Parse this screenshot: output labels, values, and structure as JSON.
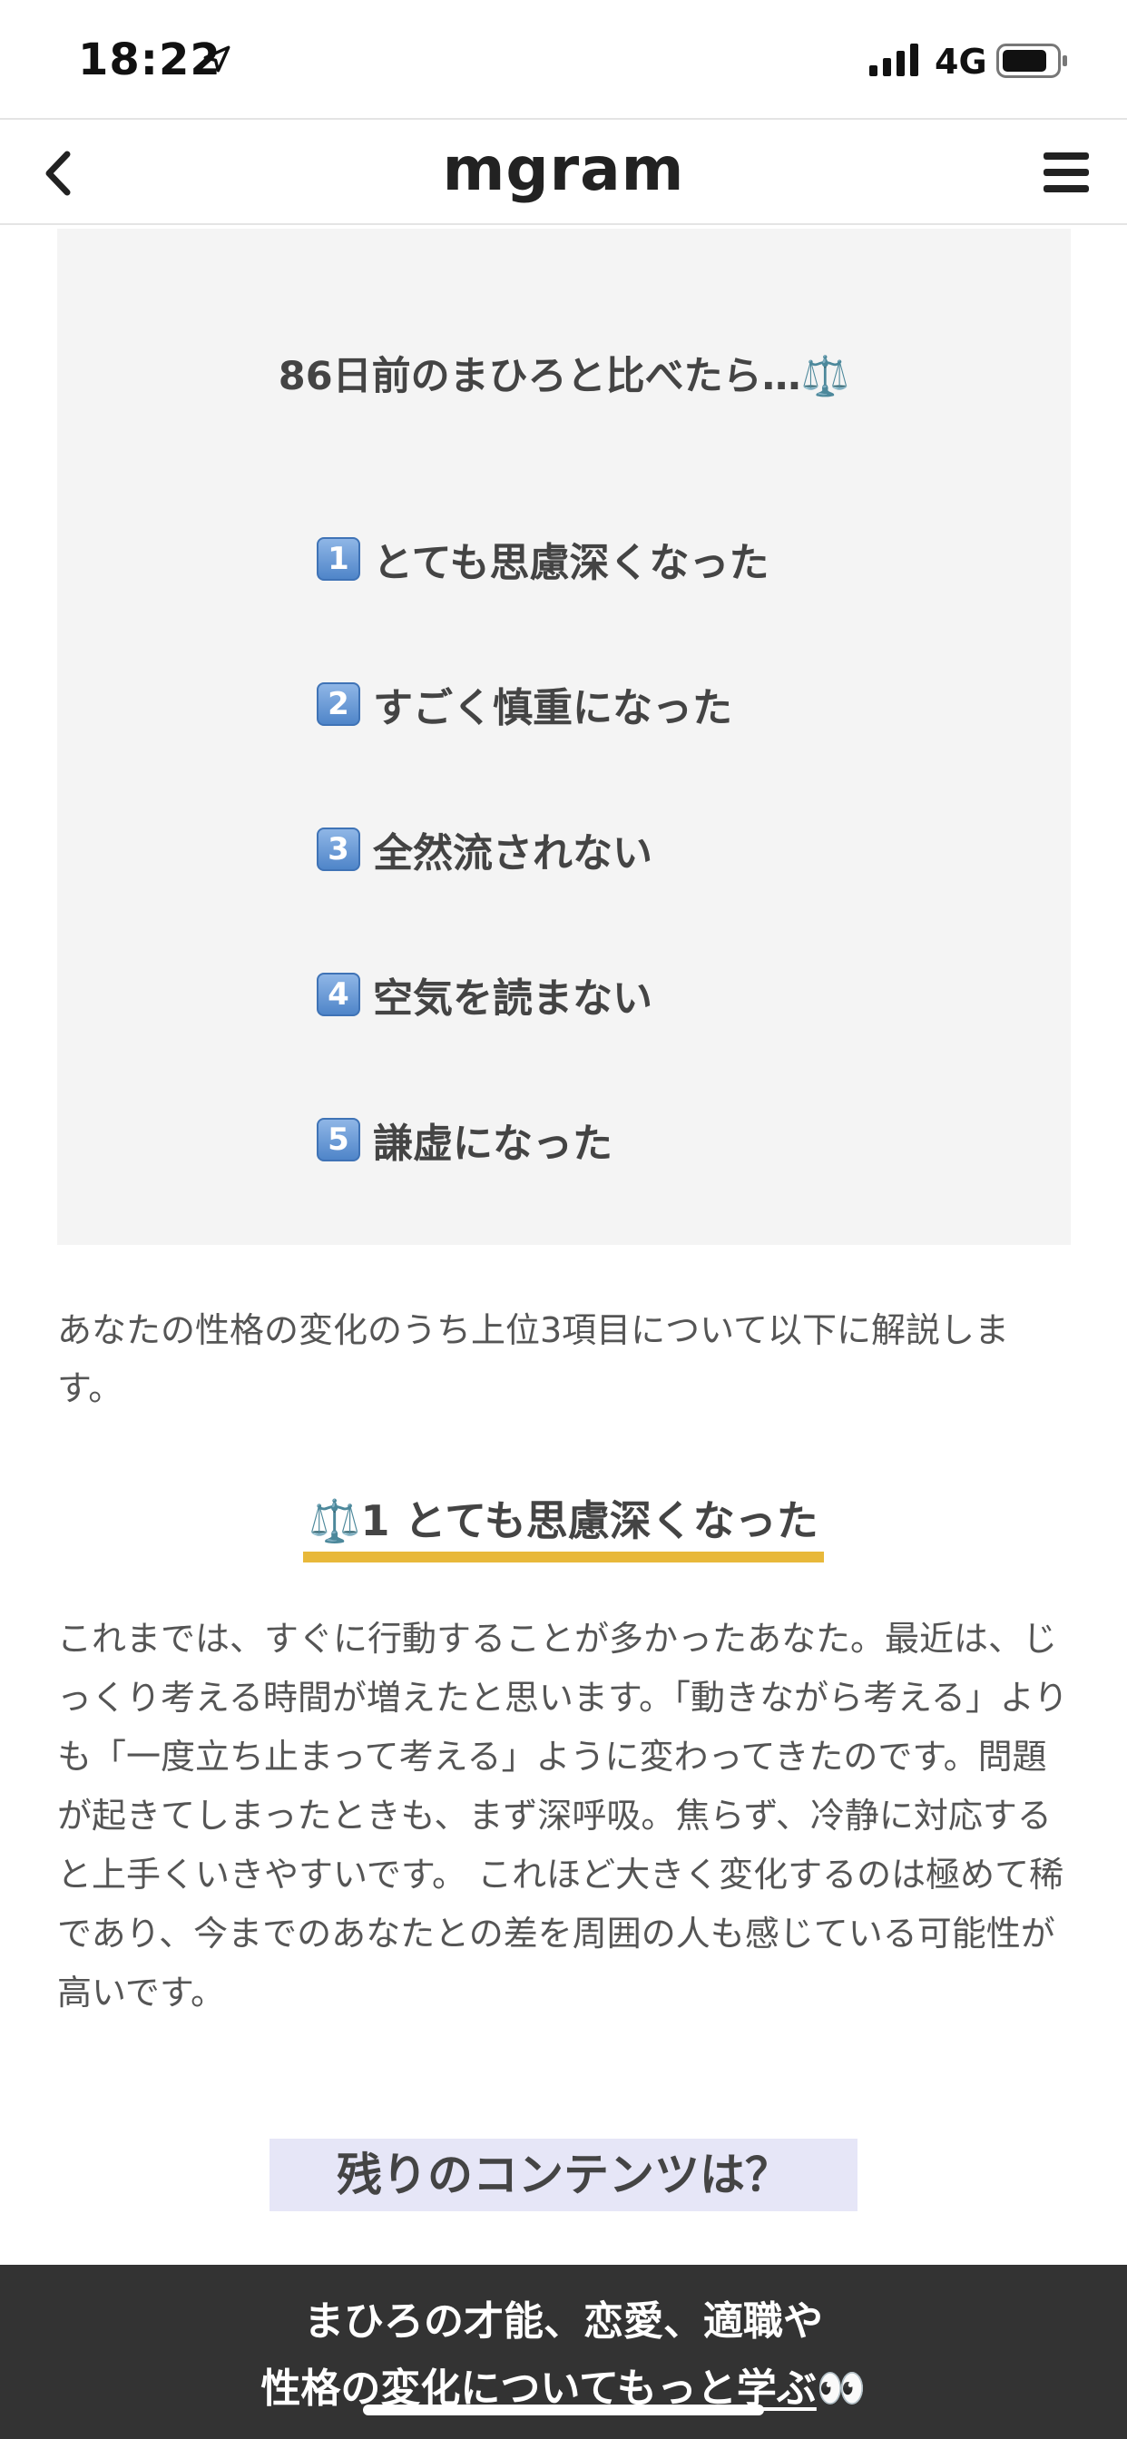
{
  "status_bar": {
    "time": "18:22",
    "network": "4G"
  },
  "nav": {
    "title": "mgram"
  },
  "summary": {
    "heading": "86日前のまひろと比べたら…⚖️",
    "items": [
      {
        "rank": "1",
        "text": "とても思慮深くなった"
      },
      {
        "rank": "2",
        "text": "すごく慎重になった"
      },
      {
        "rank": "3",
        "text": "全然流されない"
      },
      {
        "rank": "4",
        "text": "空気を読まない"
      },
      {
        "rank": "5",
        "text": "謙虚になった"
      }
    ]
  },
  "intro": "あなたの性格の変化のうち上位3項目について以下に解説します。",
  "section": {
    "title": "⚖️1 とても思慮深くなった"
  },
  "detail": "これまでは、すぐに行動することが多かったあなた。最近は、じっくり考える時間が増えたと思います。「動きながら考える」よりも「一度立ち止まって考える」ように変わってきたのです。問題が起きてしまったときも、まず深呼吸。焦らず、冷静に対応すると上手くいきやすいです。 これほど大きく変化するのは極めて稀であり、今までのあなたとの差を周囲の人も感じている可能性が高いです。",
  "remaining": {
    "title": "残りのコンテンツは？"
  },
  "cta": {
    "line1": "まひろの才能、恋愛、適職や",
    "line2_prefix": "性格の",
    "line2_underlined": "変化についてもっと学ぶ",
    "line2_suffix": "👀"
  },
  "colors": {
    "highlight": "#e8b83a",
    "banner": "#333333",
    "card": "#f4f4f4",
    "remaining_bg": "#e6e6f7"
  }
}
